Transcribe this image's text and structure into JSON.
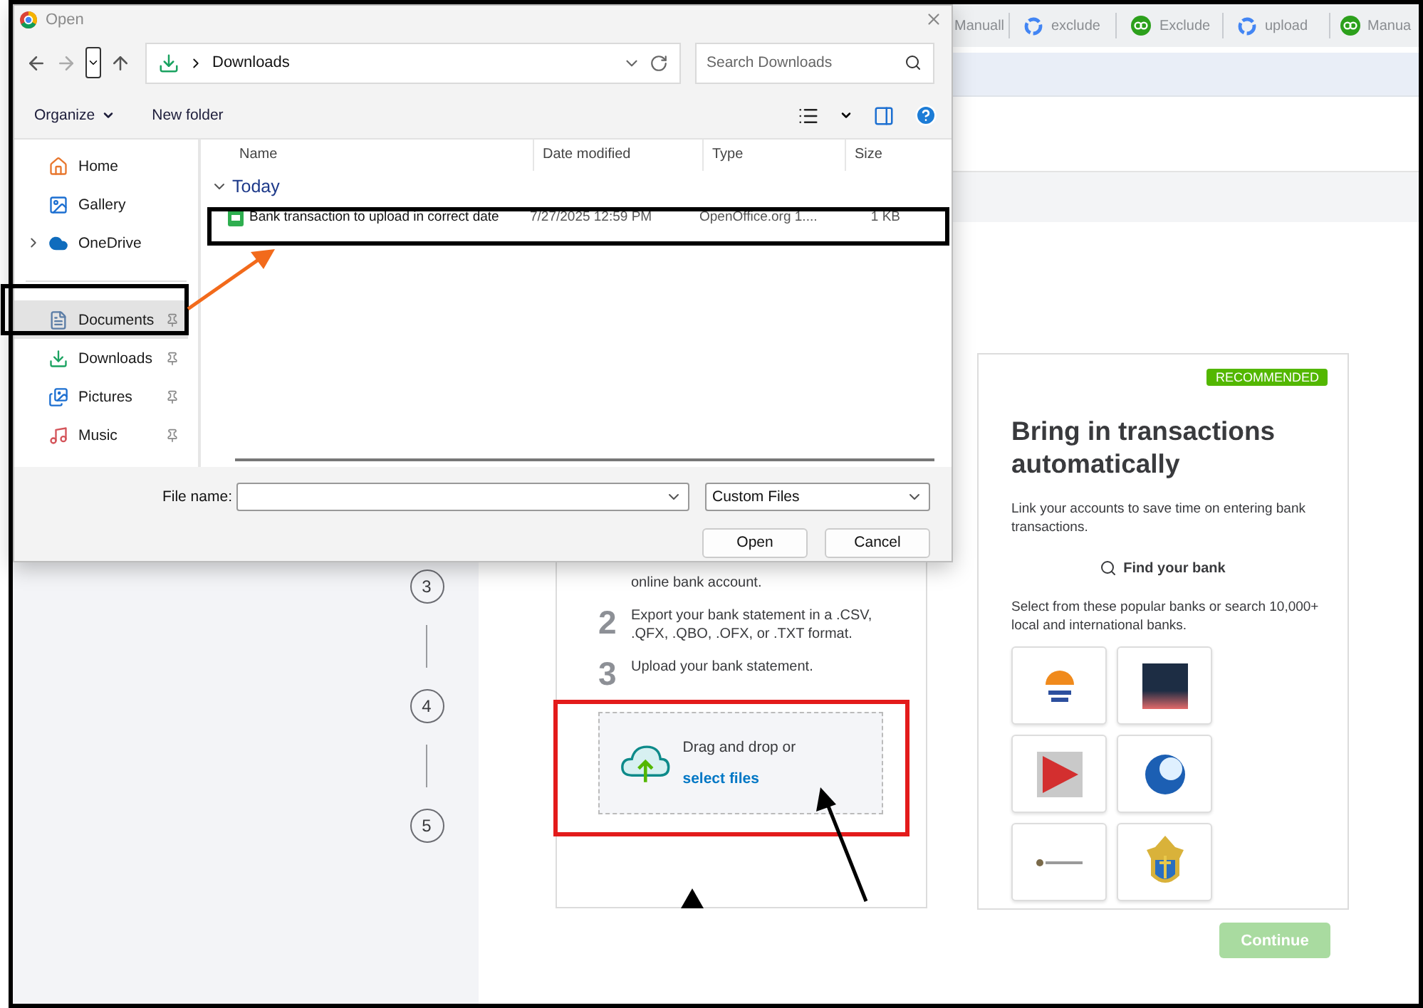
{
  "browser_tabs": [
    {
      "label": "Manuall",
      "kind": "plain"
    },
    {
      "label": "exclude",
      "kind": "google"
    },
    {
      "label": "Exclude",
      "kind": "qb"
    },
    {
      "label": "upload",
      "kind": "google"
    },
    {
      "label": "Manua",
      "kind": "qb"
    }
  ],
  "dialog": {
    "title": "Open",
    "address": "Downloads",
    "search": {
      "placeholder": "Search Downloads"
    },
    "toolbar": {
      "organize": "Organize",
      "new_folder": "New folder"
    },
    "nav_items": [
      {
        "label": "Home",
        "kind": "home",
        "pinned": false,
        "selected": false,
        "expandable": false
      },
      {
        "label": "Gallery",
        "kind": "gallery",
        "pinned": false,
        "selected": false,
        "expandable": false
      },
      {
        "label": "OneDrive",
        "kind": "cloud",
        "pinned": false,
        "selected": false,
        "expandable": true
      },
      {
        "label": "Documents",
        "kind": "documents",
        "pinned": true,
        "selected": true,
        "expandable": false
      },
      {
        "label": "Downloads",
        "kind": "download",
        "pinned": true,
        "selected": false,
        "expandable": false
      },
      {
        "label": "Pictures",
        "kind": "pictures",
        "pinned": true,
        "selected": false,
        "expandable": false
      },
      {
        "label": "Music",
        "kind": "music",
        "pinned": true,
        "selected": false,
        "expandable": false
      }
    ],
    "columns": [
      "Name",
      "Date modified",
      "Type",
      "Size"
    ],
    "groups": [
      {
        "label": "Today",
        "expanded": true,
        "files": [
          {
            "name": "Bank transaction to upload in correct date",
            "date": "7/27/2025 12:59 PM",
            "type": "OpenOffice.org 1....",
            "size": "1 KB"
          }
        ]
      }
    ],
    "file_name": {
      "label": "File name:"
    },
    "file_type": "Custom Files",
    "buttons": [
      "Open",
      "Cancel"
    ]
  },
  "steps": [
    "3",
    "4",
    "5"
  ],
  "upload_card": {
    "instructions": [
      {
        "text": "online bank account."
      },
      {
        "number": "2",
        "text": "Export your bank statement in a .CSV, .QFX, .QBO, .OFX, or .TXT format."
      },
      {
        "number": "3",
        "text": "Upload your bank statement."
      }
    ],
    "drop_zone": {
      "text": "Drag and drop or",
      "link": "select files"
    }
  },
  "connect_card": {
    "badge": "RECOMMENDED",
    "title": "Bring in transactions automatically",
    "description": "Link your accounts to save time on entering bank transactions.",
    "find_bank": "Find your bank",
    "popular": "Select from these popular banks or search 10,000+ local and international banks.",
    "banks": [
      {
        "kind": "sunburst"
      },
      {
        "kind": "square"
      },
      {
        "kind": "play"
      },
      {
        "kind": "globe"
      },
      {
        "kind": "seal"
      },
      {
        "kind": "shield"
      }
    ]
  },
  "continue": {
    "label": "Continue",
    "disabled": true
  }
}
